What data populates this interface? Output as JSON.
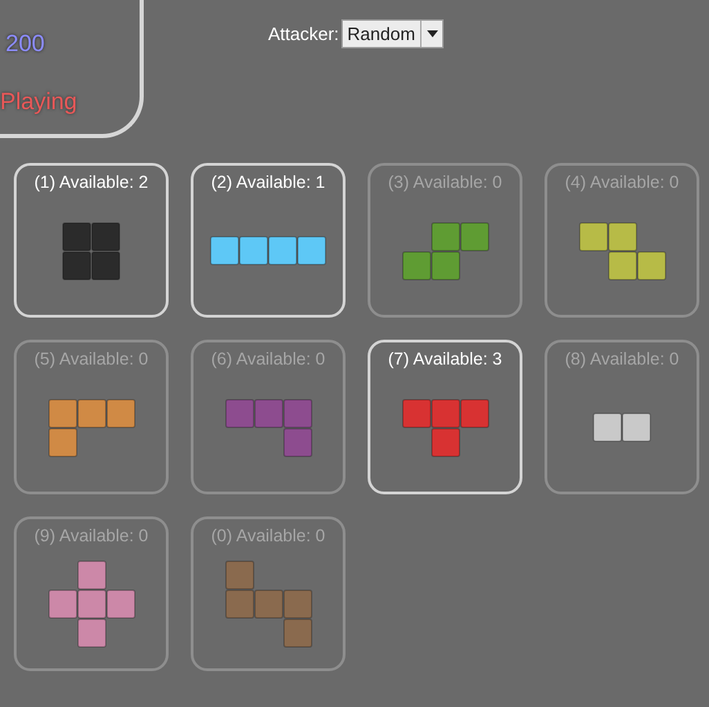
{
  "status_panel": {
    "score": "200",
    "state": "Playing"
  },
  "attacker": {
    "label": "Attacker:",
    "value": "Random"
  },
  "pieces": [
    {
      "label": "(1) Available: 2",
      "available": true,
      "color": "#2b2b2b",
      "kind": "square"
    },
    {
      "label": "(2) Available: 1",
      "available": true,
      "color": "#5ec8f6",
      "kind": "line"
    },
    {
      "label": "(3) Available: 0",
      "available": false,
      "color": "#5f9c33",
      "kind": "s"
    },
    {
      "label": "(4) Available: 0",
      "available": false,
      "color": "#b7bb47",
      "kind": "z"
    },
    {
      "label": "(5) Available: 0",
      "available": false,
      "color": "#d08a45",
      "kind": "l"
    },
    {
      "label": "(6) Available: 0",
      "available": false,
      "color": "#8d4c8f",
      "kind": "j"
    },
    {
      "label": "(7) Available: 3",
      "available": true,
      "color": "#d83232",
      "kind": "t"
    },
    {
      "label": "(8) Available: 0",
      "available": false,
      "color": "#c9c9c9",
      "kind": "domino"
    },
    {
      "label": "(9) Available: 0",
      "available": false,
      "color": "#cc88a8",
      "kind": "plus"
    },
    {
      "label": "(0) Available: 0",
      "available": false,
      "color": "#8a6a4e",
      "kind": "step"
    }
  ]
}
